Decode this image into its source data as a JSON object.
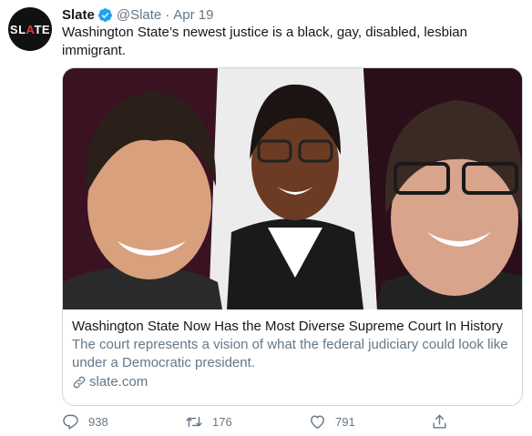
{
  "author": {
    "avatar_text": "SLATE",
    "name": "Slate",
    "handle": "@Slate",
    "separator": "·",
    "date": "Apr 19"
  },
  "tweet_text": "Washington State’s newest justice is a black, gay, disabled, lesbian immigrant.",
  "card": {
    "title": "Washington State Now Has the Most Diverse Supreme Court In History",
    "description": "The court represents a vision of what the federal judiciary could look like under a Democratic president.",
    "domain": "slate.com"
  },
  "actions": {
    "replies": "938",
    "retweets": "176",
    "likes": "791"
  },
  "icons": {
    "verified": "verified-badge-icon",
    "reply": "reply-icon",
    "retweet": "retweet-icon",
    "like": "heart-icon",
    "share": "share-icon",
    "link": "link-icon"
  },
  "colors": {
    "verified": "#1da1f2",
    "muted": "#657786",
    "text": "#14171a",
    "card_border": "#ccd6dd",
    "image_backdrop": "#3a1222"
  }
}
